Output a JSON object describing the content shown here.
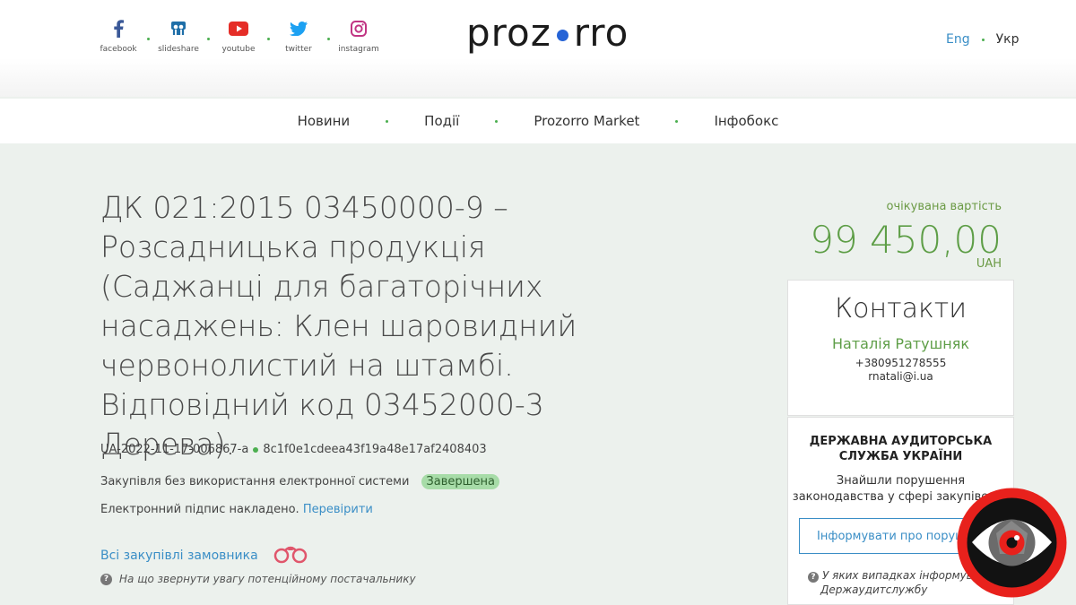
{
  "header": {
    "social": [
      {
        "icon": "facebook-icon",
        "label": "facebook"
      },
      {
        "icon": "slideshare-icon",
        "label": "slideshare"
      },
      {
        "icon": "youtube-icon",
        "label": "youtube"
      },
      {
        "icon": "twitter-icon",
        "label": "twitter"
      },
      {
        "icon": "instagram-icon",
        "label": "instagram"
      }
    ],
    "logo_left": "proz",
    "logo_right": "rro",
    "lang_en": "Eng",
    "lang_ua": "Укр"
  },
  "nav": {
    "items": [
      "Новини",
      "Події",
      "Prozorro Market",
      "Інфобокс"
    ]
  },
  "tender": {
    "title": "ДК 021:2015 03450000-9 – Розсадницька продукція (Саджанці для багаторічних насаджень: Клен шаровидний червонолистий на штамбі. Відповідний код 03452000-3 Дерева).",
    "id": "UA-2022-11-17-006867-a",
    "hash": "8c1f0e1cdeea43f19a48e17af2408403",
    "procedure": "Закупівля без використання електронної системи",
    "status": "Завершена",
    "signature_text": "Електронний підпис накладено.",
    "verify_link": "Перевірити",
    "all_purchases": "Всі закупівлі замовника",
    "hint": "На що звернути увагу потенційному постачальнику"
  },
  "expected": {
    "label": "очікувана вартість",
    "amount": "99 450,00",
    "currency": "UAH"
  },
  "contacts": {
    "heading": "Контакти",
    "name": "Наталія Ратушняк",
    "phone": "+380951278555",
    "email": "rnatali@i.ua"
  },
  "audit": {
    "heading_line1": "ДЕРЖАВНА АУДИТОРСЬКА",
    "heading_line2": "СЛУЖБА УКРАЇНИ",
    "text_line1": "Знайшли порушення",
    "text_line2": "законодавства у сфері закупівель?",
    "button": "Інформувати про порушення",
    "hint_line1": "У яких випадках інформувати",
    "hint_line2": "Держаудитслужбу"
  },
  "colors": {
    "accent_green": "#5e9e47",
    "link_blue": "#3a8ec6",
    "logo_dot": "#2563d6",
    "badge_bg": "#a7dca8",
    "eye_red": "#e8211c"
  }
}
